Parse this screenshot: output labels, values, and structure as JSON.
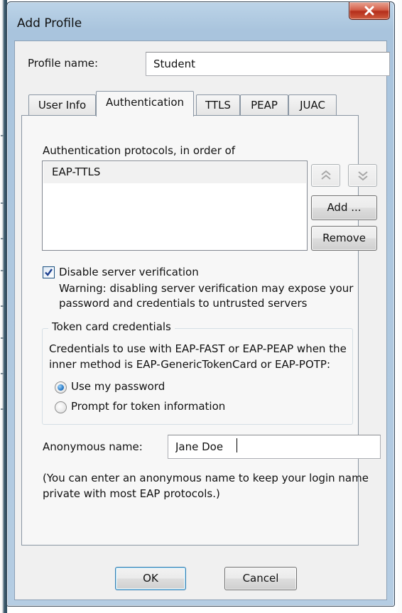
{
  "window": {
    "title": "Add Profile"
  },
  "profile": {
    "label": "Profile name:",
    "value": "Student"
  },
  "tabs": [
    {
      "label": "User Info",
      "active": false
    },
    {
      "label": "Authentication",
      "active": true
    },
    {
      "label": "TTLS",
      "active": false
    },
    {
      "label": "PEAP",
      "active": false
    },
    {
      "label": "JUAC",
      "active": false
    }
  ],
  "auth": {
    "protocols_label": "Authentication protocols, in order of",
    "protocols": [
      "EAP-TTLS"
    ],
    "add_button": "Add ...",
    "remove_button": "Remove"
  },
  "server_verification": {
    "checkbox_label": "Disable server verification",
    "checked": true,
    "warning_line1": "Warning: disabling server verification may expose your",
    "warning_line2": "password and credentials to untrusted servers"
  },
  "token": {
    "group_label": "Token card credentials",
    "description_line1": "Credentials to use with EAP-FAST or EAP-PEAP when the",
    "description_line2": "inner method is EAP-GenericTokenCard or EAP-POTP:",
    "option_password": "Use my password",
    "option_prompt": "Prompt for token information",
    "selected": "Use my password"
  },
  "anonymous": {
    "label": "Anonymous name:",
    "value": "Jane Doe",
    "hint_line1": "(You can enter an anonymous name to keep your login name",
    "hint_line2": "private with most EAP protocols.)"
  },
  "footer": {
    "ok": "OK",
    "cancel": "Cancel"
  },
  "colors": {
    "title_bar": "#a9c4dd",
    "close_button": "#c64a34",
    "radio_selected": "#2b7cc9"
  }
}
